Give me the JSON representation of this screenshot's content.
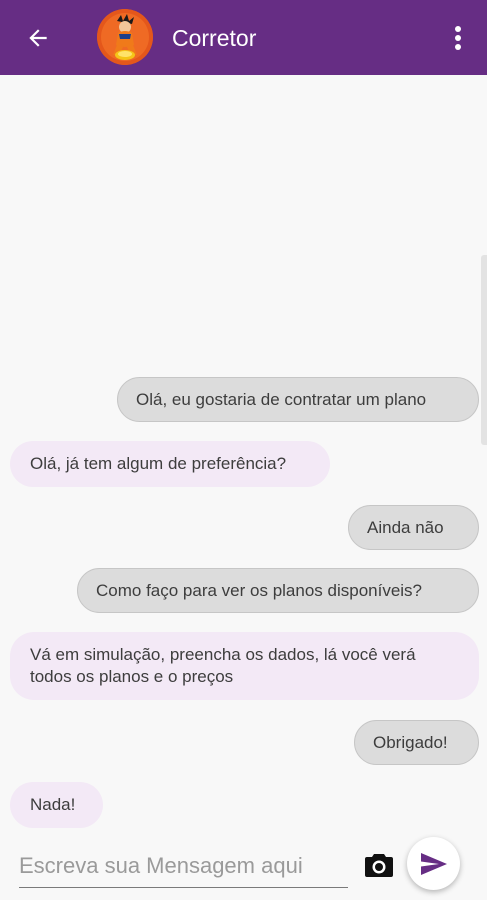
{
  "header": {
    "title": "Corretor",
    "back_icon": "arrow-back-icon",
    "menu_icon": "more-vert-icon",
    "avatar_icon": "contact-avatar",
    "background_color": "#662d84"
  },
  "messages": [
    {
      "sender": "me",
      "text": "Olá, eu gostaria de contratar um plano"
    },
    {
      "sender": "other",
      "text": "Olá, já tem algum de preferência?"
    },
    {
      "sender": "me",
      "text": "Ainda não"
    },
    {
      "sender": "me",
      "text": "Como faço para ver os planos disponíveis?"
    },
    {
      "sender": "other",
      "text": "Vá em simulação, preencha os dados, lá você verá todos os planos e o preços"
    },
    {
      "sender": "me",
      "text": "Obrigado!"
    },
    {
      "sender": "other",
      "text": "Nada!"
    }
  ],
  "composer": {
    "placeholder": "Escreva sua Mensagem aqui",
    "value": "",
    "camera_icon": "camera-icon",
    "send_icon": "send-icon",
    "accent_color": "#662d84"
  },
  "colors": {
    "sent_bubble": "#dcdcdc",
    "received_bubble": "#f3e9f6"
  }
}
